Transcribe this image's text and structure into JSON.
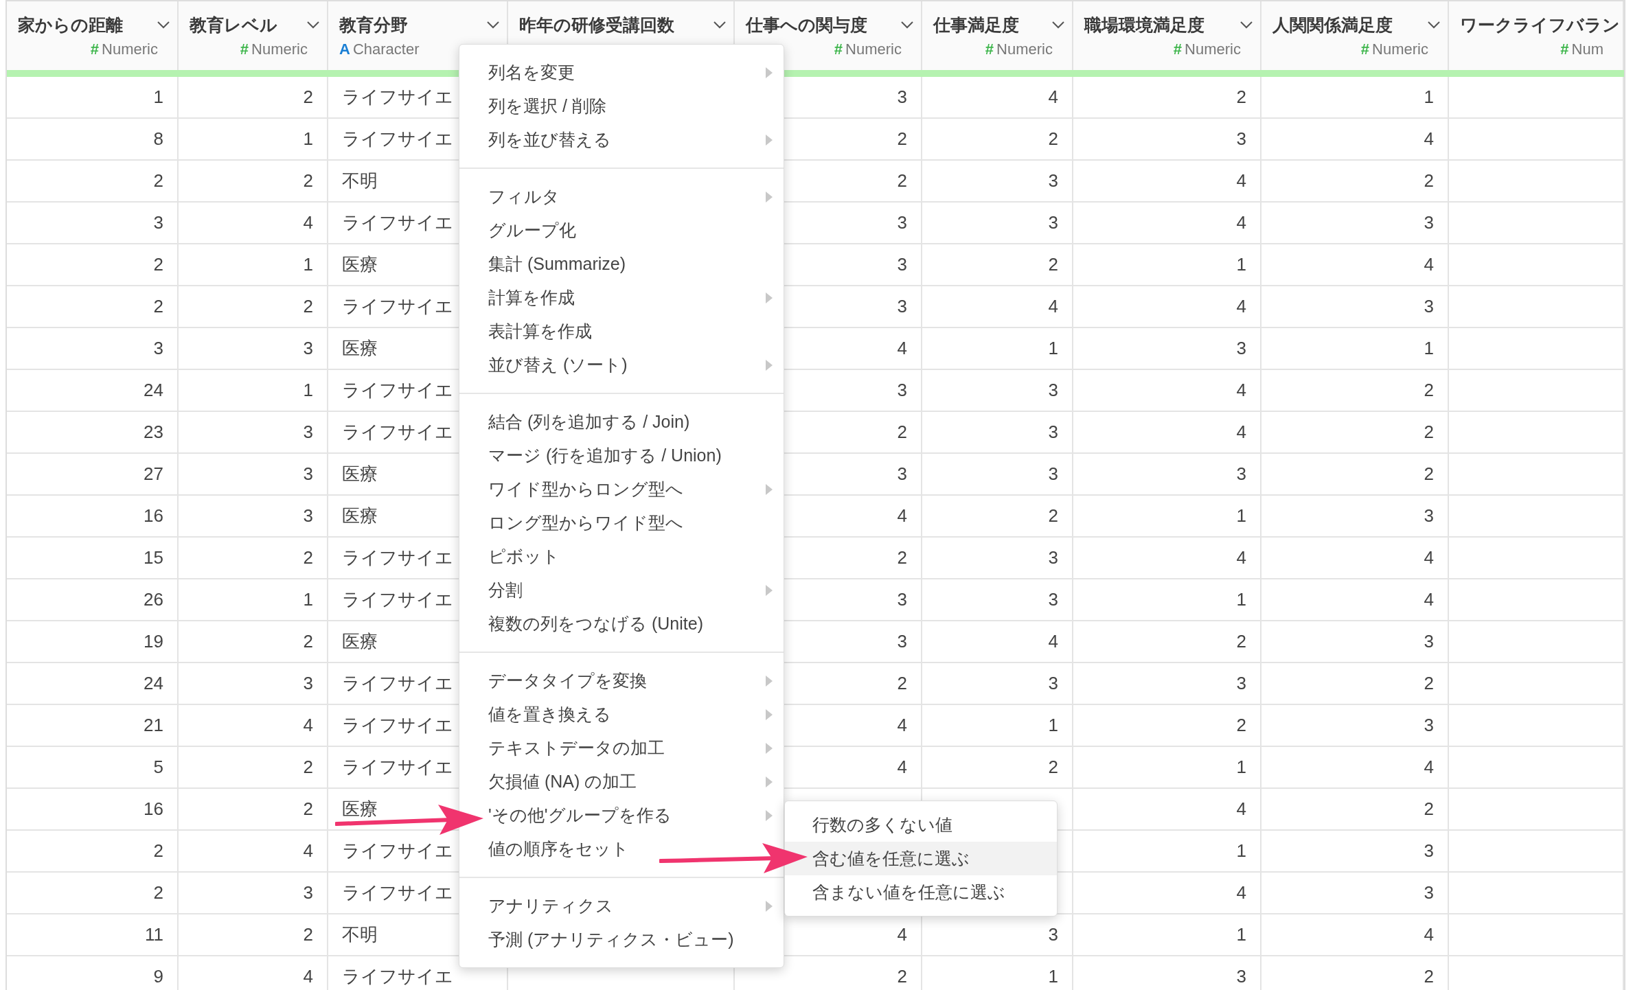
{
  "table": {
    "columns": [
      {
        "title": "家からの距離",
        "dropdown": true,
        "kind": "numeric",
        "type_icon": "#",
        "type": "Numeric"
      },
      {
        "title": "教育レベル",
        "dropdown": true,
        "kind": "numeric",
        "type_icon": "#",
        "type": "Numeric"
      },
      {
        "title": "教育分野",
        "dropdown": true,
        "kind": "character",
        "type_icon": "A",
        "type": "Character"
      },
      {
        "title": "昨年の研修受講回数",
        "dropdown": true,
        "kind": "numeric"
      },
      {
        "title": "仕事への関与度",
        "dropdown": true,
        "kind": "numeric",
        "type_icon": "#",
        "type": "Numeric"
      },
      {
        "title": "仕事満足度",
        "dropdown": true,
        "kind": "numeric",
        "type_icon": "#",
        "type": "Numeric"
      },
      {
        "title": "職場環境満足度",
        "dropdown": true,
        "kind": "numeric",
        "type_icon": "#",
        "type": "Numeric"
      },
      {
        "title": "人関関係満足度",
        "dropdown": true,
        "kind": "numeric",
        "type_icon": "#",
        "type": "Numeric"
      },
      {
        "title": "ワークライフバラン",
        "dropdown": false,
        "kind": "numeric",
        "type_icon": "#",
        "type": "Num"
      }
    ],
    "rows": [
      [
        "1",
        "2",
        "ライフサイエ",
        null,
        "3",
        "4",
        "2",
        "1"
      ],
      [
        "8",
        "1",
        "ライフサイエ",
        null,
        "2",
        "2",
        "3",
        "4"
      ],
      [
        "2",
        "2",
        "不明",
        null,
        "2",
        "3",
        "4",
        "2"
      ],
      [
        "3",
        "4",
        "ライフサイエ",
        null,
        "3",
        "3",
        "4",
        "3"
      ],
      [
        "2",
        "1",
        "医療",
        null,
        "3",
        "2",
        "1",
        "4"
      ],
      [
        "2",
        "2",
        "ライフサイエ",
        null,
        "3",
        "4",
        "4",
        "3"
      ],
      [
        "3",
        "3",
        "医療",
        null,
        "4",
        "1",
        "3",
        "1"
      ],
      [
        "24",
        "1",
        "ライフサイエ",
        null,
        "3",
        "3",
        "4",
        "2"
      ],
      [
        "23",
        "3",
        "ライフサイエ",
        null,
        "2",
        "3",
        "4",
        "2"
      ],
      [
        "27",
        "3",
        "医療",
        null,
        "3",
        "3",
        "3",
        "2"
      ],
      [
        "16",
        "3",
        "医療",
        null,
        "4",
        "2",
        "1",
        "3"
      ],
      [
        "15",
        "2",
        "ライフサイエ",
        null,
        "2",
        "3",
        "4",
        "4"
      ],
      [
        "26",
        "1",
        "ライフサイエ",
        null,
        "3",
        "3",
        "1",
        "4"
      ],
      [
        "19",
        "2",
        "医療",
        null,
        "3",
        "4",
        "2",
        "3"
      ],
      [
        "24",
        "3",
        "ライフサイエ",
        null,
        "2",
        "3",
        "3",
        "2"
      ],
      [
        "21",
        "4",
        "ライフサイエ",
        null,
        "4",
        "1",
        "2",
        "3"
      ],
      [
        "5",
        "2",
        "ライフサイエ",
        null,
        "4",
        "2",
        "1",
        "4"
      ],
      [
        "16",
        "2",
        "医療",
        null,
        null,
        null,
        "4",
        "2"
      ],
      [
        "2",
        "4",
        "ライフサイエ",
        null,
        null,
        null,
        "1",
        "3"
      ],
      [
        "2",
        "3",
        "ライフサイエ",
        null,
        null,
        null,
        "4",
        "3"
      ],
      [
        "11",
        "2",
        "不明",
        null,
        "4",
        "3",
        "1",
        "4"
      ],
      [
        "9",
        "4",
        "ライフサイエ",
        null,
        "2",
        "1",
        "3",
        "2"
      ]
    ]
  },
  "context_menu": {
    "groups": [
      [
        {
          "label": "列名を変更",
          "submenu": true
        },
        {
          "label": "列を選択 / 削除",
          "submenu": false
        },
        {
          "label": "列を並び替える",
          "submenu": true
        }
      ],
      [
        {
          "label": "フィルタ",
          "submenu": true
        },
        {
          "label": "グループ化",
          "submenu": false
        },
        {
          "label": "集計 (Summarize)",
          "submenu": false
        },
        {
          "label": "計算を作成",
          "submenu": true
        },
        {
          "label": "表計算を作成",
          "submenu": false
        },
        {
          "label": "並び替え (ソート)",
          "submenu": true
        }
      ],
      [
        {
          "label": "結合 (列を追加する / Join)",
          "submenu": false
        },
        {
          "label": "マージ (行を追加する / Union)",
          "submenu": false
        },
        {
          "label": "ワイド型からロング型へ",
          "submenu": true
        },
        {
          "label": "ロング型からワイド型へ",
          "submenu": false
        },
        {
          "label": "ピボット",
          "submenu": false
        },
        {
          "label": "分割",
          "submenu": true
        },
        {
          "label": "複数の列をつなげる (Unite)",
          "submenu": false
        }
      ],
      [
        {
          "label": "データタイプを変換",
          "submenu": true
        },
        {
          "label": "値を置き換える",
          "submenu": true
        },
        {
          "label": "テキストデータの加工",
          "submenu": true
        },
        {
          "label": "欠損値 (NA) の加工",
          "submenu": true
        },
        {
          "label": "'その他'グループを作る",
          "submenu": true
        },
        {
          "label": "値の順序をセット",
          "submenu": false
        }
      ],
      [
        {
          "label": "アナリティクス",
          "submenu": true
        },
        {
          "label": "予測 (アナリティクス・ビュー)",
          "submenu": false
        }
      ]
    ]
  },
  "submenu": {
    "items": [
      {
        "label": "行数の多くない値",
        "selected": false
      },
      {
        "label": "含む値を任意に選ぶ",
        "selected": true
      },
      {
        "label": "含まない値を任意に選ぶ",
        "selected": false
      }
    ]
  }
}
